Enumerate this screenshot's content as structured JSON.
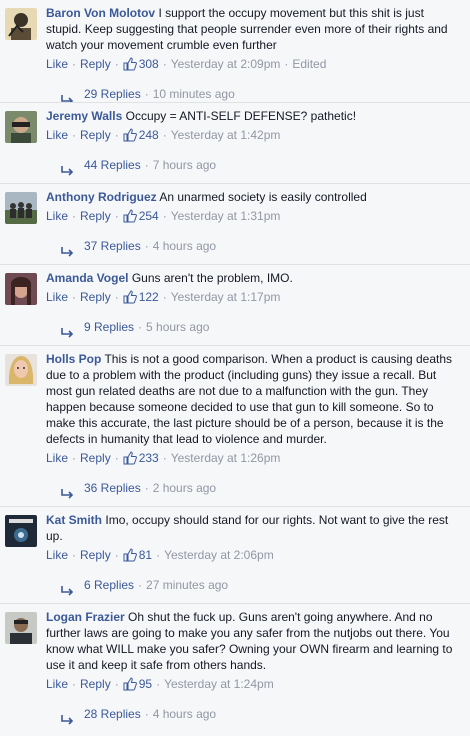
{
  "comments": [
    {
      "author": "Baron Von Molotov",
      "text": "I support the occupy movement but this shit is just stupid. Keep suggesting that people surrender even more of their rights and watch your movement crumble even further",
      "like_label": "Like",
      "reply_label": "Reply",
      "likes": "308",
      "time": "Yesterday at 2:09pm",
      "edited": "Edited",
      "replies": "29 Replies",
      "replies_time": "10 minutes ago"
    },
    {
      "author": "Jeremy Walls",
      "text": "Occupy = ANTI-SELF DEFENSE? pathetic!",
      "like_label": "Like",
      "reply_label": "Reply",
      "likes": "248",
      "time": "Yesterday at 1:42pm",
      "replies": "44 Replies",
      "replies_time": "7 hours ago"
    },
    {
      "author": "Anthony Rodriguez",
      "text": "An unarmed society is easily controlled",
      "like_label": "Like",
      "reply_label": "Reply",
      "likes": "254",
      "time": "Yesterday at 1:31pm",
      "replies": "37 Replies",
      "replies_time": "4 hours ago"
    },
    {
      "author": "Amanda Vogel",
      "text": "Guns aren't the problem, IMO.",
      "like_label": "Like",
      "reply_label": "Reply",
      "likes": "122",
      "time": "Yesterday at 1:17pm",
      "replies": "9 Replies",
      "replies_time": "5 hours ago"
    },
    {
      "author": "Holls Pop",
      "text": "This is not a good comparison. When a product is causing deaths due to a problem with the product (including guns) they issue a recall. But most gun related deaths are not due to a malfunction with the gun. They happen because someone decided to use that gun to kill someone. So to make this accurate, the last picture should be of a person, because it is the defects in humanity that lead to violence and murder.",
      "like_label": "Like",
      "reply_label": "Reply",
      "likes": "233",
      "time": "Yesterday at 1:26pm",
      "replies": "36 Replies",
      "replies_time": "2 hours ago"
    },
    {
      "author": "Kat Smith",
      "text": "Imo, occupy should stand for our rights. Not want to give the rest up.",
      "like_label": "Like",
      "reply_label": "Reply",
      "likes": "81",
      "time": "Yesterday at 2:06pm",
      "replies": "6 Replies",
      "replies_time": "27 minutes ago"
    },
    {
      "author": "Logan Frazier",
      "text": "Oh shut the fuck up. Guns aren't going anywhere. And no further laws are going to make you any safer from the nutjobs out there. You know what WILL make you safer? Owning your OWN firearm and learning to use it and keep it safe from others hands.",
      "like_label": "Like",
      "reply_label": "Reply",
      "likes": "95",
      "time": "Yesterday at 1:24pm",
      "replies": "28 Replies",
      "replies_time": "4 hours ago"
    }
  ],
  "colors": {
    "link": "#3b5998",
    "meta": "#9197a3",
    "background": "#f6f7f9"
  },
  "icons": {
    "like": "thumbs-up-icon",
    "replies": "reply-arrow-icon"
  }
}
